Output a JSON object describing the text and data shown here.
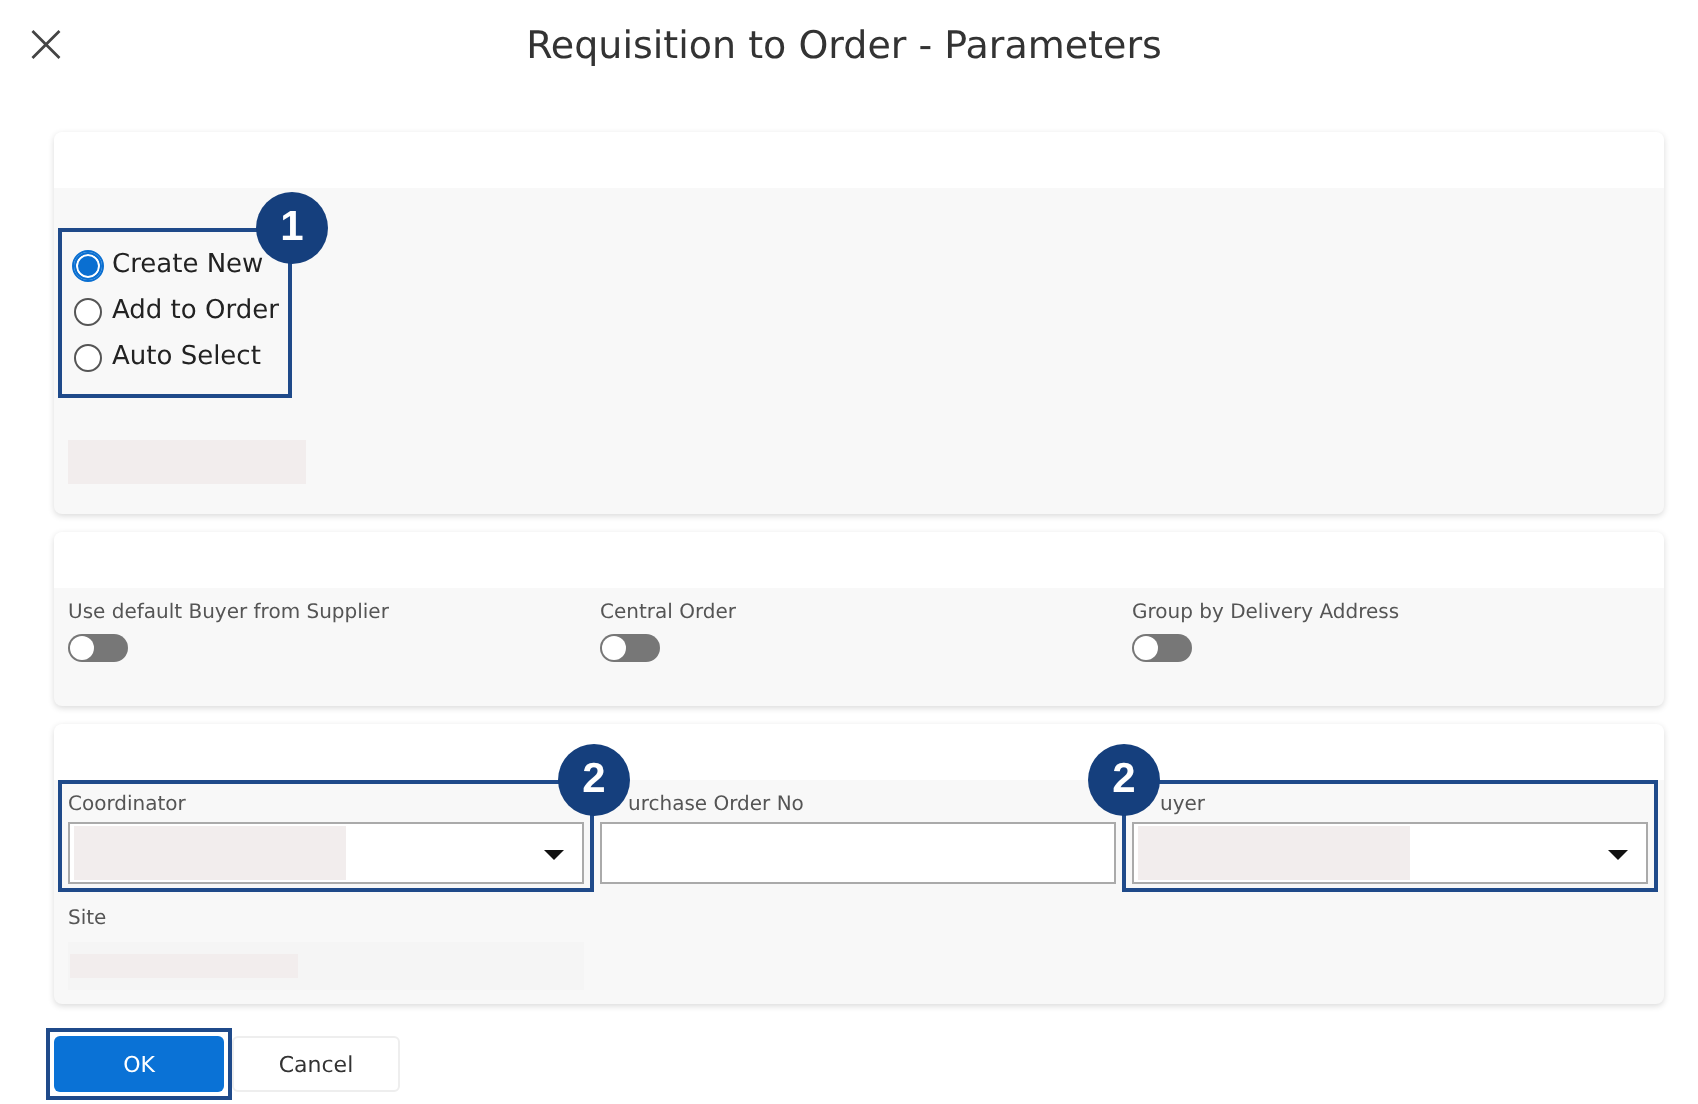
{
  "window": {
    "title": "Requisition to Order - Parameters",
    "close": "×"
  },
  "order_mode": {
    "badge": "1",
    "options": [
      {
        "label": "Create New",
        "selected": true
      },
      {
        "label": "Add to Order",
        "selected": false
      },
      {
        "label": "Auto Select",
        "selected": false
      }
    ]
  },
  "toggles": [
    {
      "label": "Use default Buyer from Supplier",
      "on": false
    },
    {
      "label": "Central Order",
      "on": false
    },
    {
      "label": "Group by Delivery Address",
      "on": false
    }
  ],
  "fields": [
    {
      "label": "Coordinator",
      "kind": "dropdown",
      "badge": "2"
    },
    {
      "label": "urchase Order No",
      "kind": "text"
    },
    {
      "label": "uyer",
      "kind": "dropdown",
      "badge": "2"
    }
  ],
  "site": {
    "label": "Site"
  },
  "buttons": [
    {
      "label": "OK",
      "kind": "primary",
      "framed": true
    },
    {
      "label": "Cancel",
      "kind": "secondary",
      "framed": false
    }
  ]
}
